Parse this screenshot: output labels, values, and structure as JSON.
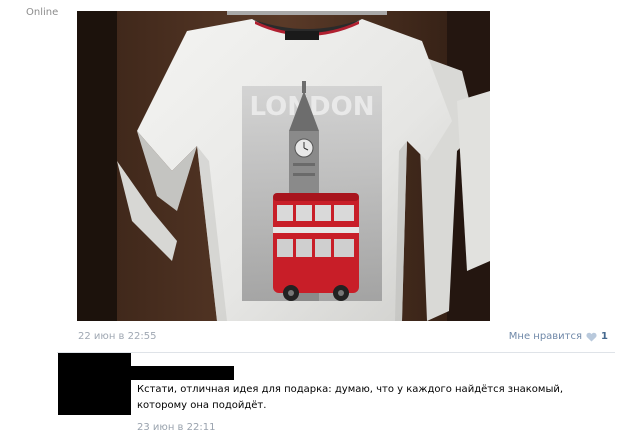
{
  "status": {
    "online_label": "Online"
  },
  "post": {
    "image_alt": "Белая футболка с принтом London, Биг-Бен и красный двухэтажный автобус",
    "date": "22 июн в 22:55",
    "like_label": "Мне нравится",
    "like_count": "1",
    "like_icon": "heart-icon"
  },
  "comment": {
    "text": "Кстати, отличная идея для подарка: думаю, что у каждого найдётся знакомый, которому она подойдёт.",
    "date": "23 июн в 22:11"
  },
  "colors": {
    "link": "#45688e",
    "meta": "#a0a8b3",
    "bus_red": "#c81e28"
  }
}
